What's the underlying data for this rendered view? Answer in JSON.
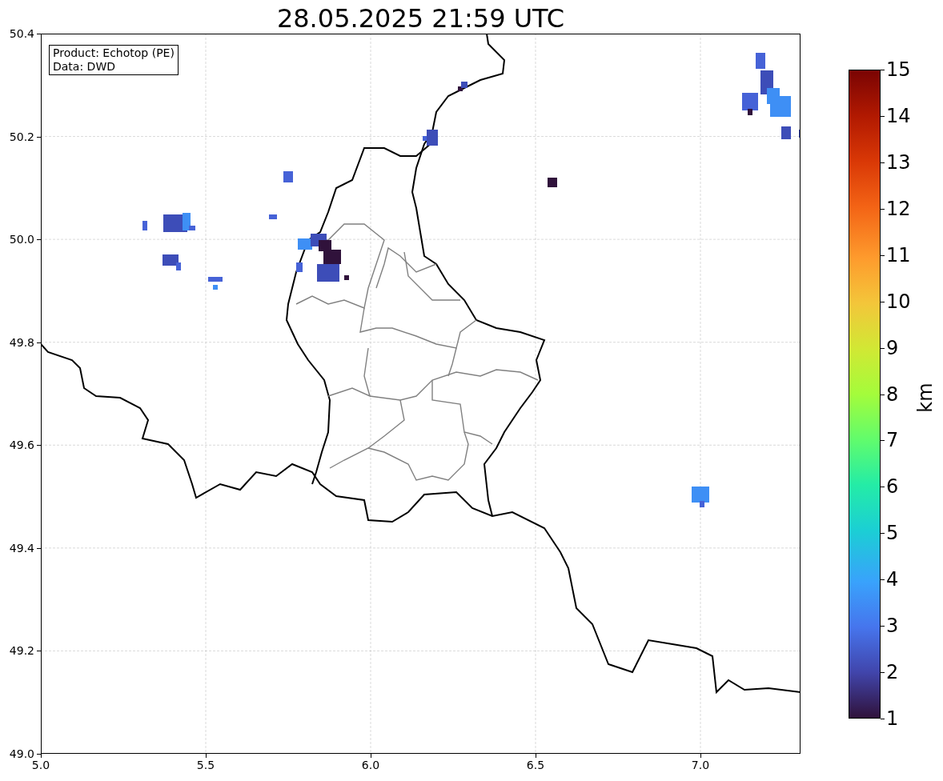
{
  "title": "28.05.2025 21:59 UTC",
  "legend": [
    "Product: Echotop (PE)",
    "Data: DWD"
  ],
  "x_ticks": [
    "5.0",
    "5.5",
    "6.0",
    "6.5",
    "7.0"
  ],
  "y_ticks": [
    "50.4",
    "50.2",
    "50.0",
    "49.8",
    "49.6",
    "49.4",
    "49.2",
    "49.0"
  ],
  "colorbar": {
    "label": "km",
    "ticks": [
      "15",
      "14",
      "13",
      "12",
      "11",
      "10",
      "9",
      "8",
      "7",
      "6",
      "5",
      "4",
      "3",
      "2",
      "1"
    ]
  }
}
